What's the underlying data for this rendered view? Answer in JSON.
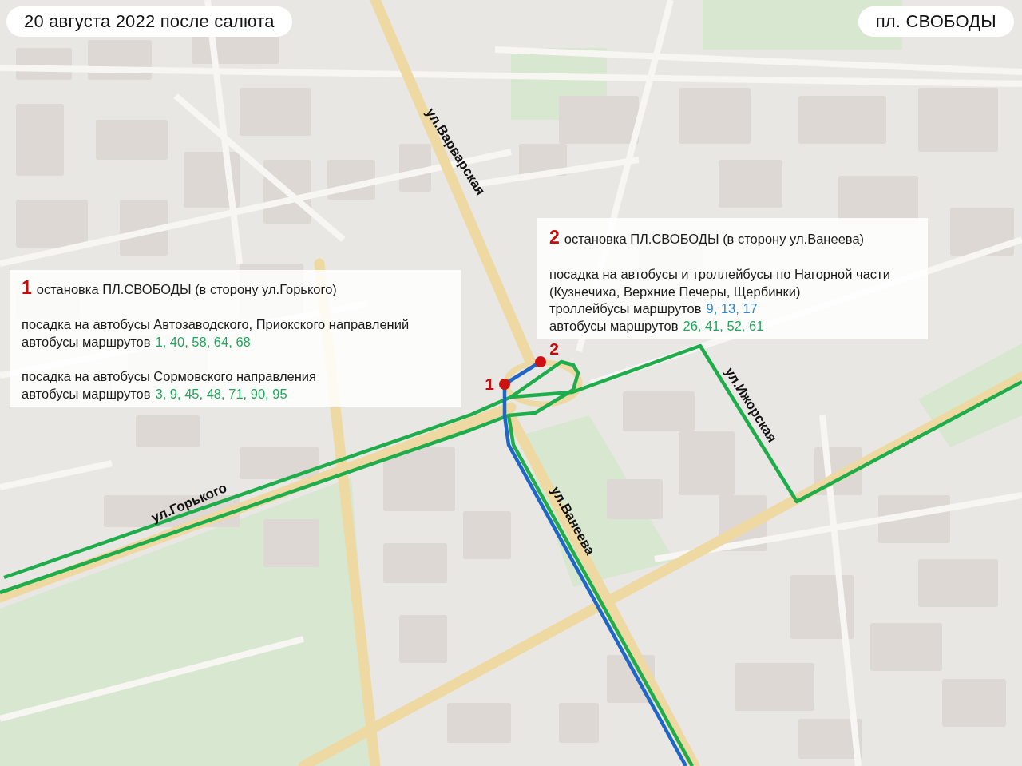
{
  "header": {
    "date_label": "20 августа 2022 после салюта",
    "place_label": "пл. СВОБОДЫ"
  },
  "panels": [
    {
      "number": "1",
      "title": "остановка ПЛ.СВОБОДЫ (в сторону ул.Горького)",
      "groups": [
        [
          {
            "kind": "text",
            "text": "посадка на автобусы Автозаводского, Приокского направлений"
          },
          {
            "kind": "routes",
            "label": "автобусы маршрутов",
            "routes": "1, 40, 58, 64, 68",
            "color": "#1fa85a"
          }
        ],
        [
          {
            "kind": "text",
            "text": "посадка на автобусы Сормовского направления"
          },
          {
            "kind": "routes",
            "label": "автобусы маршрутов",
            "routes": "3, 9, 45, 48, 71, 90, 95",
            "color": "#1fa85a"
          }
        ]
      ]
    },
    {
      "number": "2",
      "title": "остановка ПЛ.СВОБОДЫ (в сторону ул.Ванеева)",
      "groups": [
        [
          {
            "kind": "text",
            "text": "посадка на автобусы и троллейбусы по Нагорной части"
          },
          {
            "kind": "text",
            "text": "(Кузнечиха, Верхние Печеры, Щербинки)"
          },
          {
            "kind": "routes",
            "label": "троллейбусы маршрутов",
            "routes": "9, 13, 17",
            "color": "#2f86cf"
          },
          {
            "kind": "routes",
            "label": "автобусы маршрутов",
            "routes": "26, 41, 52, 61",
            "color": "#1fa85a"
          }
        ]
      ]
    }
  ],
  "map": {
    "routes": [
      {
        "kind": "bus",
        "color": "#1fac4b"
      },
      {
        "kind": "trolleybus",
        "color": "#1e66c8"
      }
    ],
    "stops": [
      {
        "number": "1"
      },
      {
        "number": "2"
      }
    ],
    "street_labels": [
      "ул.Варварская",
      "ул.Горького",
      "ул.Ванеева",
      "ул.Ижорская"
    ]
  }
}
